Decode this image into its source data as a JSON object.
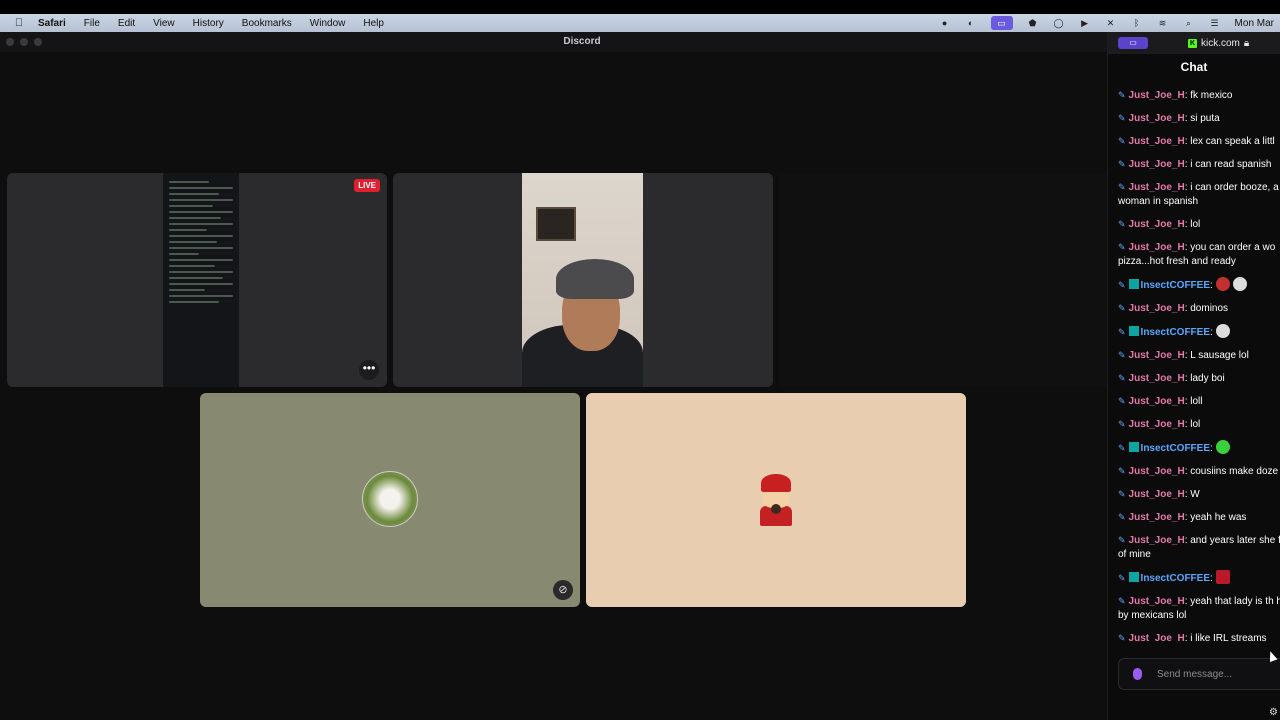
{
  "menubar": {
    "app": "Safari",
    "items": [
      "File",
      "Edit",
      "View",
      "History",
      "Bookmarks",
      "Window",
      "Help"
    ],
    "clock": "Mon Mar"
  },
  "discord": {
    "window_title": "Discord",
    "live_badge": "LIVE",
    "more_label": "•••"
  },
  "kick": {
    "url": "kick.com",
    "chat_title": "Chat",
    "send_placeholder": "Send message...",
    "messages": [
      {
        "user": "Just_Joe_H",
        "text": ": fk mexico"
      },
      {
        "user": "Just_Joe_H",
        "text": ": si puta"
      },
      {
        "user": "Just_Joe_H",
        "text": ": lex can speak a littl"
      },
      {
        "user": "Just_Joe_H",
        "text": ": i can read spanish"
      },
      {
        "user": "Just_Joe_H",
        "text": ": i can order booze, a a woman in spanish"
      },
      {
        "user": "Just_Joe_H",
        "text": ": lol"
      },
      {
        "user": "Just_Joe_H",
        "text": ": you can order a wo pizza...hot fresh and ready"
      },
      {
        "user": "InsectCOFFEE",
        "text": ":"
      },
      {
        "user": "Just_Joe_H",
        "text": ": dominos"
      },
      {
        "user": "InsectCOFFEE",
        "text": ":"
      },
      {
        "user": "Just_Joe_H",
        "text": ": L sausage lol"
      },
      {
        "user": "Just_Joe_H",
        "text": ": lady boi"
      },
      {
        "user": "Just_Joe_H",
        "text": ": loll"
      },
      {
        "user": "Just_Joe_H",
        "text": ": lol"
      },
      {
        "user": "InsectCOFFEE",
        "text": ":"
      },
      {
        "user": "Just_Joe_H",
        "text": ": cousiins make doze"
      },
      {
        "user": "Just_Joe_H",
        "text": ": W"
      },
      {
        "user": "Just_Joe_H",
        "text": ": yeah he was"
      },
      {
        "user": "Just_Joe_H",
        "text": ": and years later she friend of mine"
      },
      {
        "user": "InsectCOFFEE",
        "text": ":"
      },
      {
        "user": "Just_Joe_H",
        "text": ": yeah that lady is th hated by mexicans lol"
      },
      {
        "user": "Just_Joe_H",
        "text": ": i like IRL streams"
      }
    ]
  }
}
